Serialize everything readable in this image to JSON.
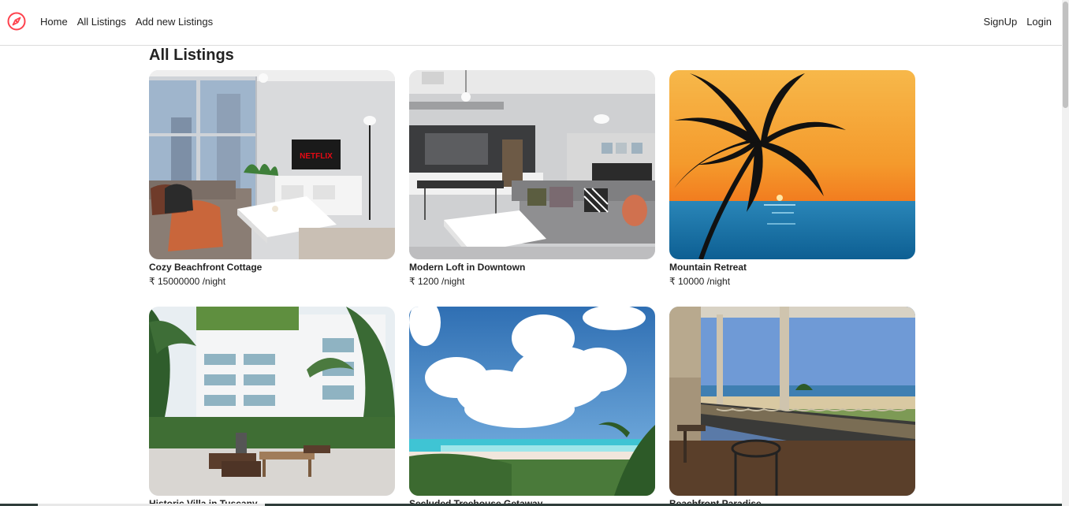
{
  "nav": {
    "brand_icon": "compass-icon",
    "brand_color": "#fe424d",
    "links": [
      "Home",
      "All Listings",
      "Add new Listings"
    ],
    "auth": [
      "SignUp",
      "Login"
    ]
  },
  "page": {
    "title": "All Listings"
  },
  "listings": [
    {
      "title": "Cozy Beachfront Cottage",
      "price": "₹ 15000000 /night",
      "image": "living-room-photo"
    },
    {
      "title": "Modern Loft in Downtown",
      "price": "₹ 1200 /night",
      "image": "loft-interior-photo"
    },
    {
      "title": "Mountain Retreat",
      "price": "₹ 10000 /night",
      "image": "palm-sunset-photo"
    },
    {
      "title": "Historic Villa in Tuscany",
      "price": "",
      "image": "courtyard-building-photo"
    },
    {
      "title": "Secluded Treehouse Getaway",
      "price": "",
      "image": "beach-clouds-photo"
    },
    {
      "title": "Beachfront Paradise",
      "price": "",
      "image": "porch-beach-view-photo"
    }
  ]
}
